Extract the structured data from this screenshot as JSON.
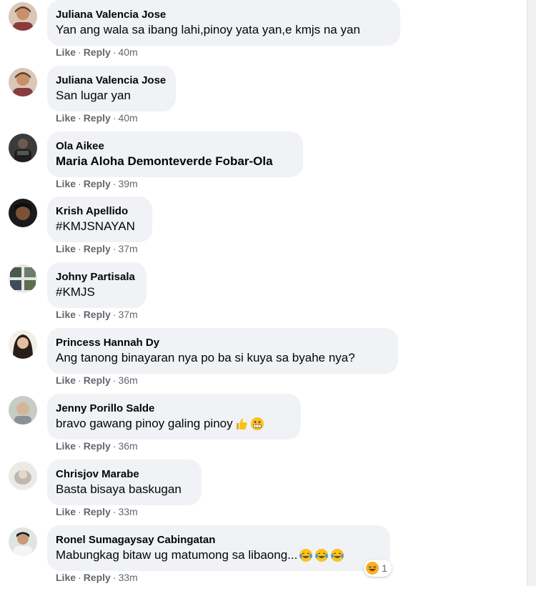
{
  "actions": {
    "like": "Like",
    "reply": "Reply",
    "separator": "·"
  },
  "comments": [
    {
      "author": "Juliana Valencia Jose",
      "text": "Yan ang wala sa ibang lahi,pinoy yata yan,e kmjs na yan",
      "time": "40m"
    },
    {
      "author": "Juliana Valencia Jose",
      "text": "San lugar yan",
      "time": "40m"
    },
    {
      "author": "Ola Aikee",
      "text": "Maria Aloha Demonteverde Fobar-Ola",
      "time": "39m"
    },
    {
      "author": "Krish Apellido",
      "text": "#KMJSNAYAN",
      "time": "37m"
    },
    {
      "author": "Johny Partisala",
      "text": "#KMJS",
      "time": "37m"
    },
    {
      "author": "Princess Hannah Dy",
      "text": "Ang tanong binayaran nya po ba si kuya sa byahe nya?",
      "time": "36m"
    },
    {
      "author": "Jenny Porillo Salde",
      "text": "bravo gawang pinoy galing pinoy",
      "time": "36m"
    },
    {
      "author": "Chrisjov Marabe",
      "text": "Basta bisaya baskugan",
      "time": "33m"
    },
    {
      "author": "Ronel Sumagaysay Cabingatan",
      "text": "Mabungkag bitaw ug matumong sa libaong...",
      "time": "33m",
      "reaction_count": "1"
    }
  ],
  "icons": {
    "thumbs_up": "thumbs-up-emoji",
    "grimace": "grimacing-emoji",
    "laugh": "laughing-tears-emoji",
    "haha": "haha-reaction-icon"
  },
  "colors": {
    "bubble": "#f0f2f5",
    "meta": "#65676b",
    "text": "#050505"
  }
}
